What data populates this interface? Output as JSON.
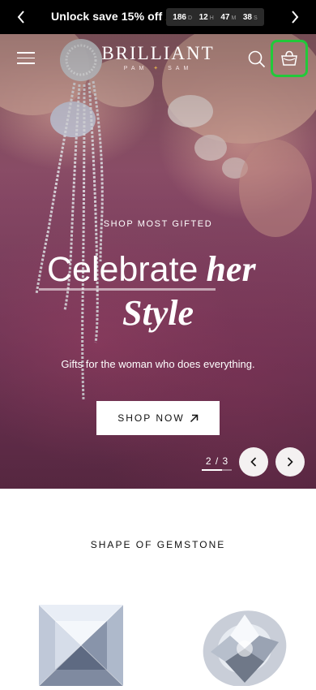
{
  "announcement": {
    "message": "Unlock save 15% off",
    "bolt": "⚡",
    "countdown": [
      {
        "value": "186",
        "unit": "D"
      },
      {
        "value": "12",
        "unit": "H"
      },
      {
        "value": "47",
        "unit": "M"
      },
      {
        "value": "38",
        "unit": "S"
      }
    ]
  },
  "header": {
    "logo_name": "BRILLIANT",
    "logo_sub_left": "PAM",
    "logo_sub_star": "✦",
    "logo_sub_right": "SAM"
  },
  "hero": {
    "eyebrow": "SHOP MOST GIFTED",
    "headline_plain": "Celebrate",
    "headline_italic": "her",
    "headline_line2": "Style",
    "subcopy": "Gifts for the woman who does everything.",
    "cta_label": "SHOP NOW",
    "pager": "2 / 3",
    "slide_progress": 0.67
  },
  "colors": {
    "cart_highlight": "#22c93a",
    "logo_star": "#d9a84e",
    "bolt": "#f2c200"
  },
  "shape_section": {
    "title": "SHAPE OF GEMSTONE"
  }
}
